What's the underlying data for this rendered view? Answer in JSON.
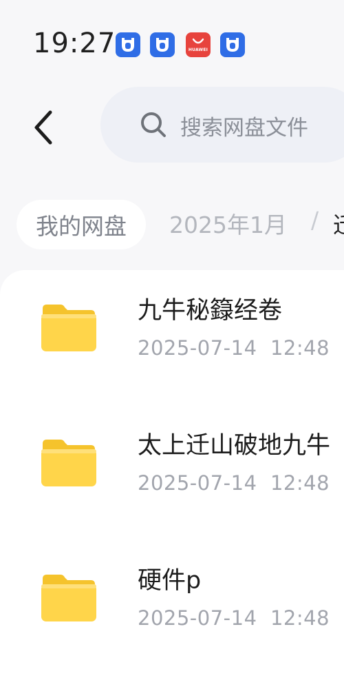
{
  "status_bar": {
    "time": "19:27",
    "notification_icons": [
      "app-icon",
      "app-icon",
      "huawei-appgallery-icon",
      "app-icon"
    ],
    "huawei_label": "HUAWEI"
  },
  "header": {
    "search_placeholder": "搜索网盘文件"
  },
  "breadcrumb": {
    "home": "我的网盘",
    "month": "2025年1月",
    "separator": "/",
    "current": "迁"
  },
  "files": [
    {
      "name": "九牛秘籙经卷",
      "date": "2025-07-14",
      "time": "12:48"
    },
    {
      "name": "太上迁山破地九牛",
      "date": "2025-07-14",
      "time": "12:48"
    },
    {
      "name": "硬件p",
      "date": "2025-07-14",
      "time": "12:48"
    }
  ],
  "colors": {
    "accent_blue": "#2f6de6",
    "huawei_red": "#e7433d",
    "folder_yellow": "#ffd54a"
  }
}
